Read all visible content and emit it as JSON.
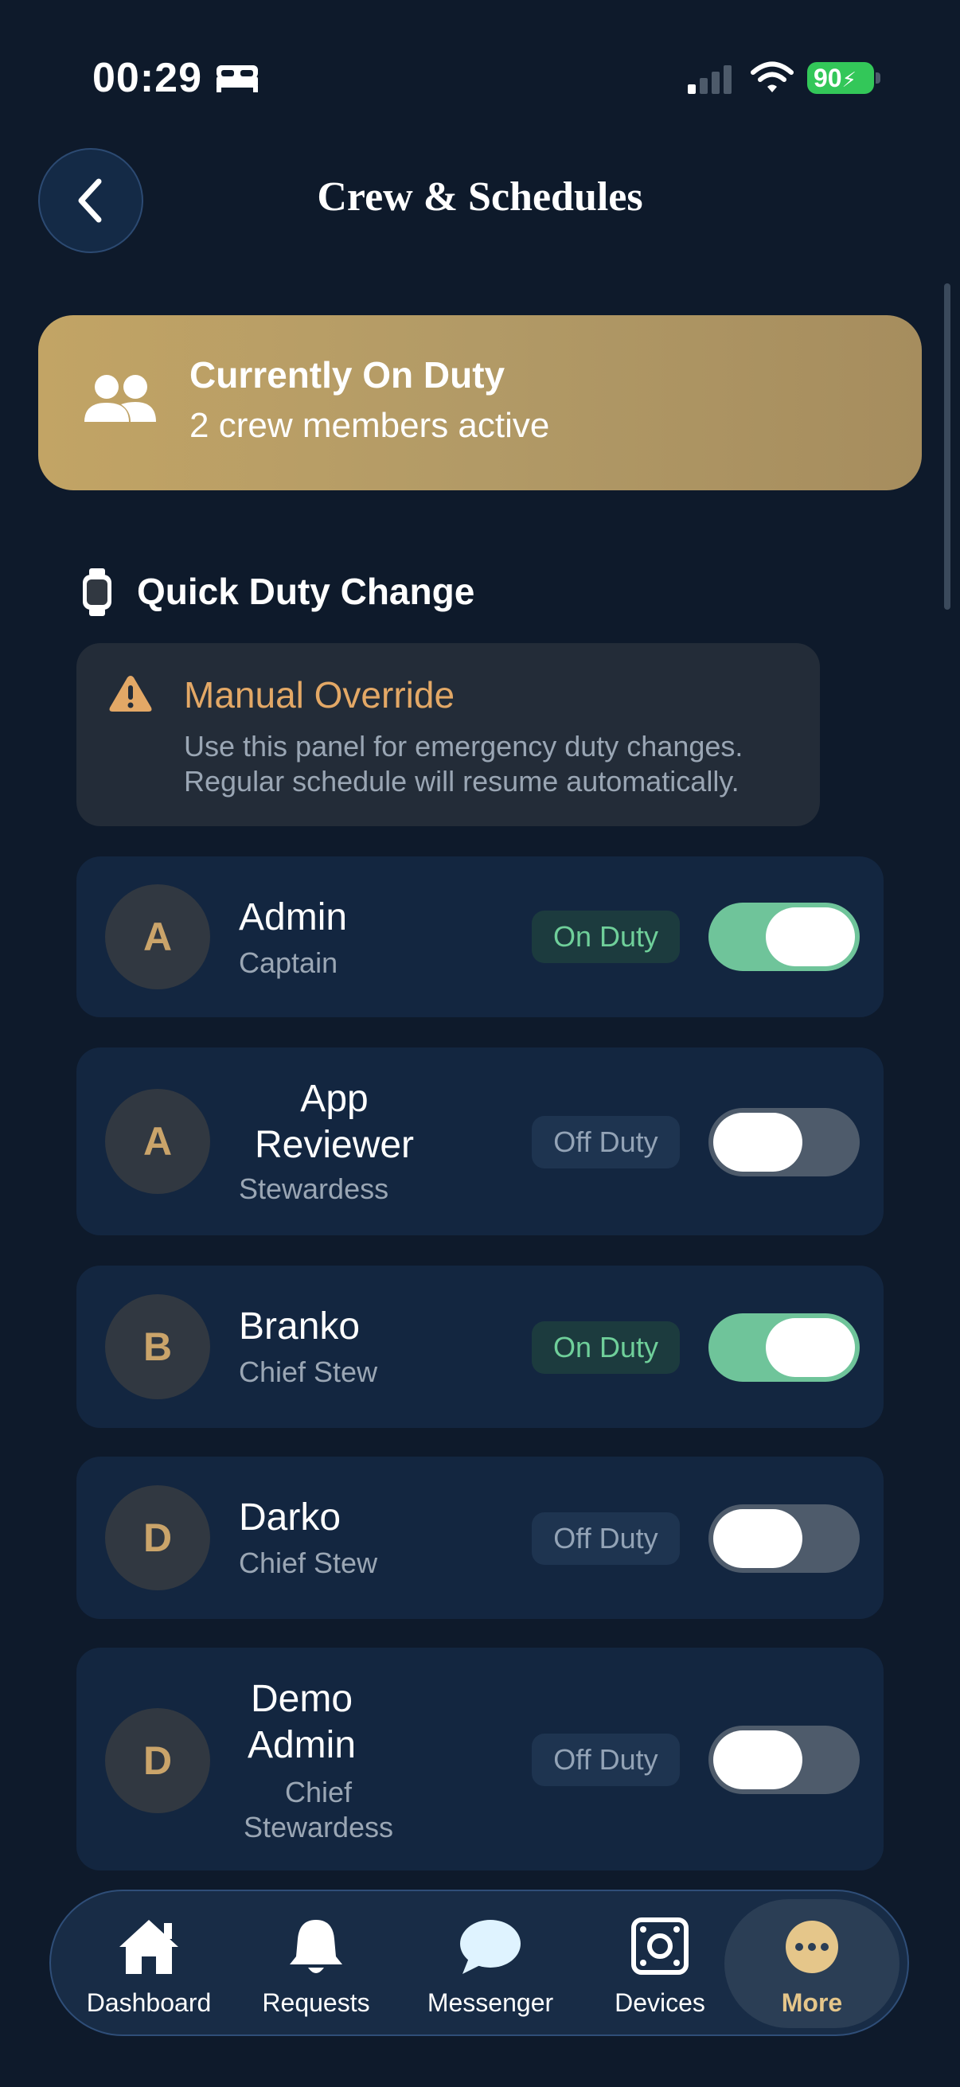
{
  "status_bar": {
    "time": "00:29",
    "battery": "90",
    "icons": [
      "bed-icon",
      "cellular-signal-icon",
      "wifi-icon",
      "battery-icon"
    ]
  },
  "header": {
    "title": "Crew & Schedules",
    "back_icon": "chevron-left-icon"
  },
  "duty_banner": {
    "title": "Currently On Duty",
    "subtitle": "2 crew members active",
    "icon": "people-icon"
  },
  "quick_duty": {
    "title": "Quick Duty Change",
    "icon": "watch-icon"
  },
  "override": {
    "title": "Manual Override",
    "text": "Use this panel for emergency duty changes. Regular schedule will resume automatically.",
    "icon": "warning-icon"
  },
  "crew": [
    {
      "initial": "A",
      "name": "Admin",
      "role": "Captain",
      "status": "On Duty",
      "on": true
    },
    {
      "initial": "A",
      "name": "App Reviewer",
      "role": "Stewardess",
      "status": "Off Duty",
      "on": false
    },
    {
      "initial": "B",
      "name": "Branko",
      "role": "Chief Stew",
      "status": "On Duty",
      "on": true
    },
    {
      "initial": "D",
      "name": "Darko",
      "role": "Chief Stew",
      "status": "Off Duty",
      "on": false
    },
    {
      "initial": "D",
      "name": "Demo Admin",
      "role": "Chief Stewardess",
      "status": "Off Duty",
      "on": false
    }
  ],
  "tabs": [
    {
      "label": "Dashboard",
      "icon": "home-icon"
    },
    {
      "label": "Requests",
      "icon": "bell-icon"
    },
    {
      "label": "Messenger",
      "icon": "chat-bubble-icon"
    },
    {
      "label": "Devices",
      "icon": "device-icon"
    },
    {
      "label": "More",
      "icon": "more-icon",
      "active": true
    }
  ],
  "colors": {
    "background": "#0e1a2b",
    "card": "#132640",
    "accent_gold": "#c2a465",
    "on_green": "#6fc49a",
    "warning_orange": "#e3a866"
  }
}
